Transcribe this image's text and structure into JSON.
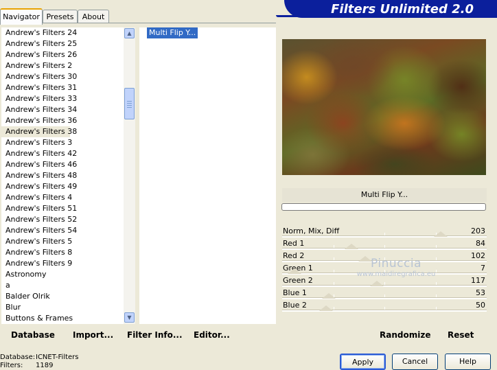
{
  "app": {
    "title": "Filters Unlimited 2.0"
  },
  "tabs": [
    {
      "label": "Navigator",
      "active": true
    },
    {
      "label": "Presets",
      "active": false
    },
    {
      "label": "About",
      "active": false
    }
  ],
  "categories": {
    "items": [
      "Andrew's Filters 24",
      "Andrew's Filters 25",
      "Andrew's Filters 26",
      "Andrew's Filters 2",
      "Andrew's Filters 30",
      "Andrew's Filters 31",
      "Andrew's Filters 33",
      "Andrew's Filters 34",
      "Andrew's Filters 36",
      "Andrew's Filters 38",
      "Andrew's Filters 3",
      "Andrew's Filters 42",
      "Andrew's Filters 46",
      "Andrew's Filters 48",
      "Andrew's Filters 49",
      "Andrew's Filters 4",
      "Andrew's Filters 51",
      "Andrew's Filters 52",
      "Andrew's Filters 54",
      "Andrew's Filters 5",
      "Andrew's Filters 8",
      "Andrew's Filters 9",
      "Astronomy",
      "a",
      "Balder Olrik",
      "Blur",
      "Buttons & Frames"
    ],
    "selected": "Andrew's Filters 38"
  },
  "filters": {
    "items": [
      "Multi Flip Y..."
    ],
    "selected": "Multi Flip Y..."
  },
  "preview": {
    "filter_name": "Multi Flip Y..."
  },
  "sliders": [
    {
      "label": "Norm, Mix, Diff",
      "value": "203",
      "fraction": 0.796
    },
    {
      "label": "Red 1",
      "value": "84",
      "fraction": 0.329
    },
    {
      "label": "Red 2",
      "value": "102",
      "fraction": 0.4
    },
    {
      "label": "Green 1",
      "value": "7",
      "fraction": 0.027
    },
    {
      "label": "Green 2",
      "value": "117",
      "fraction": 0.459
    },
    {
      "label": "Blue 1",
      "value": "53",
      "fraction": 0.208
    },
    {
      "label": "Blue 2",
      "value": "50",
      "fraction": 0.196
    }
  ],
  "watermark": {
    "name": "Pinuccia",
    "site": "www.maidiregrafica.eu"
  },
  "actions": {
    "database": "Database",
    "import": "Import...",
    "filter_info": "Filter Info...",
    "editor": "Editor...",
    "randomize": "Randomize",
    "reset": "Reset"
  },
  "footer": {
    "database_key": "Database:",
    "database_value": "ICNET-Filters",
    "filters_key": "Filters:",
    "filters_value": "1189"
  },
  "buttons": {
    "apply": "Apply",
    "cancel": "Cancel",
    "help": "Help"
  },
  "colors": {
    "banner": "#0b1f9c",
    "selection": "#316ac5",
    "dialog_bg": "#ece9d8"
  }
}
